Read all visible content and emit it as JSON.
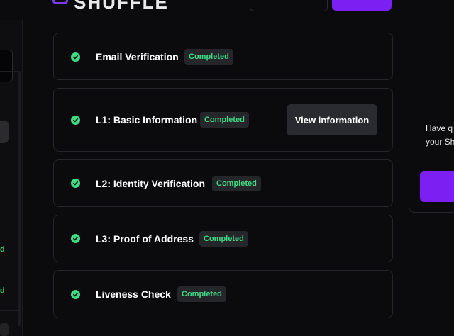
{
  "header": {
    "logo_text": "SHUFFLE"
  },
  "sidebar": {
    "status_1": "d",
    "status_2": "d"
  },
  "steps": [
    {
      "title": "Email Verification",
      "status": "Completed"
    },
    {
      "title": "L1: Basic Information",
      "status": "Completed",
      "action_label": "View information"
    },
    {
      "title": "L2: Identity Verification",
      "status": "Completed"
    },
    {
      "title": "L3: Proof of Address",
      "status": "Completed"
    },
    {
      "title": "Liveness Check",
      "status": "Completed"
    }
  ],
  "help_panel": {
    "line_1": "Have q",
    "line_2": "your Sh"
  },
  "colors": {
    "accent": "#7c1ff3",
    "success": "#3ddc84",
    "background": "#0b0b0d"
  }
}
